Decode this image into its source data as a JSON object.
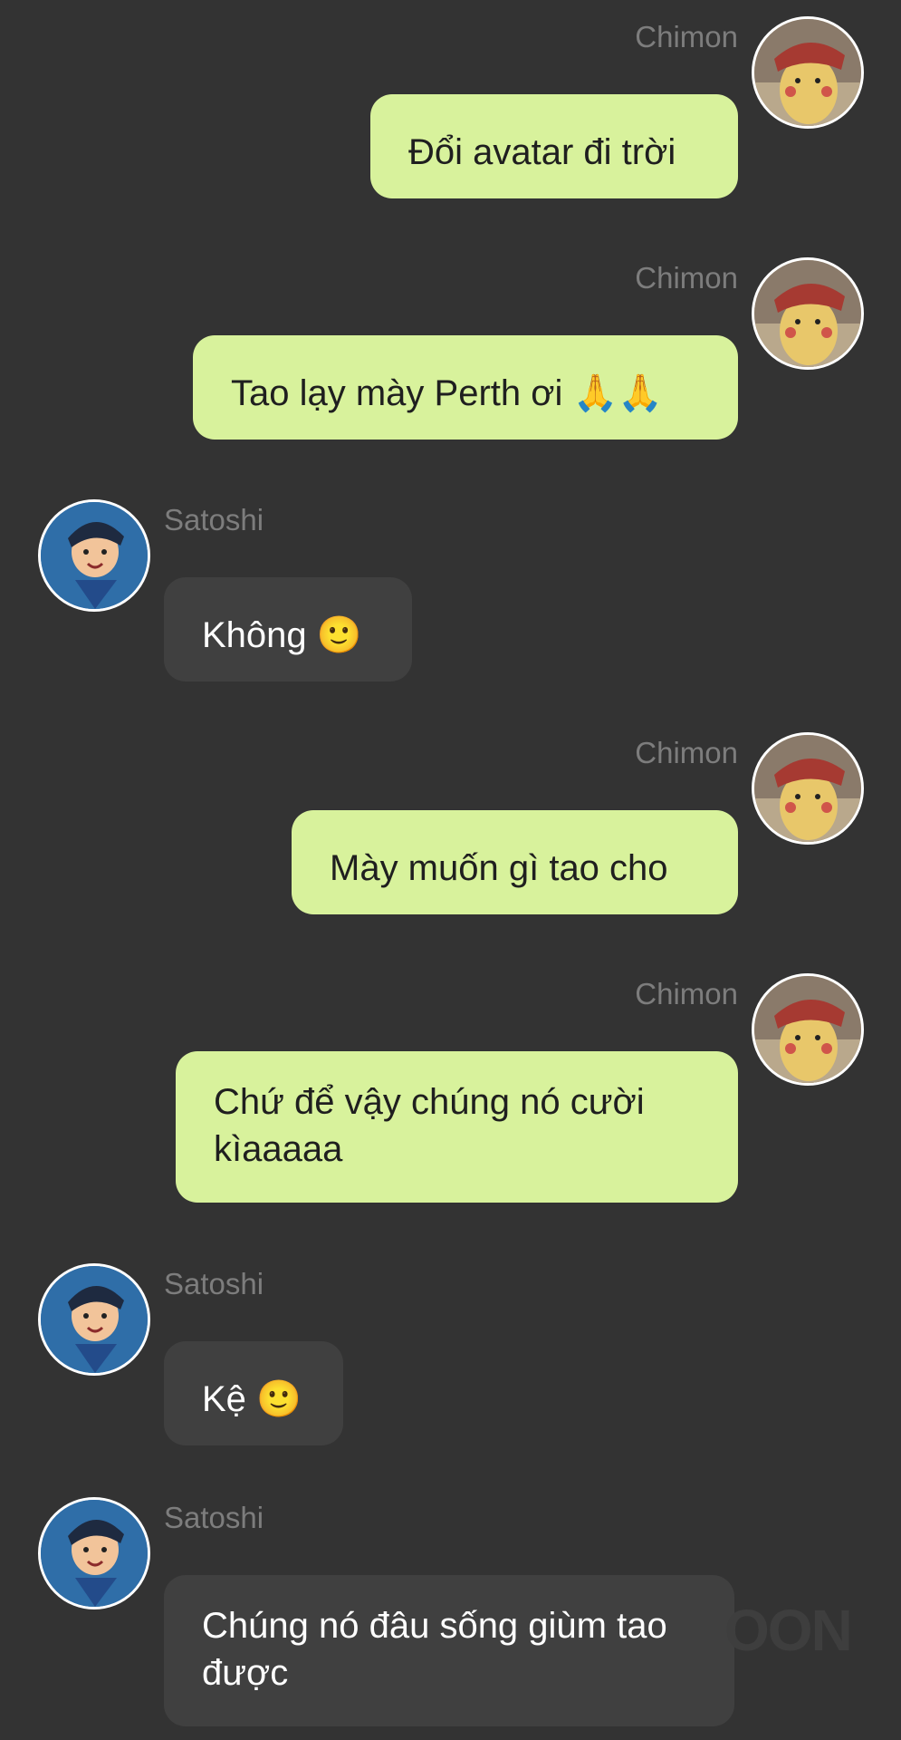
{
  "colors": {
    "background": "#333333",
    "outgoing_bubble": "#d8f29c",
    "incoming_bubble": "#404040",
    "sender_name": "#7d7d7d"
  },
  "messages": [
    {
      "direction": "out",
      "sender": "Chimon",
      "avatar_icon": "pikachu-avatar-icon",
      "text": "Đổi avatar đi trời"
    },
    {
      "direction": "out",
      "sender": "Chimon",
      "avatar_icon": "pikachu-avatar-icon",
      "text": "Tao lạy mày Perth ơi 🙏🙏"
    },
    {
      "direction": "in",
      "sender": "Satoshi",
      "avatar_icon": "ash-avatar-icon",
      "text": "Không 🙂"
    },
    {
      "direction": "out",
      "sender": "Chimon",
      "avatar_icon": "pikachu-avatar-icon",
      "text": "Mày muốn gì tao cho"
    },
    {
      "direction": "out",
      "sender": "Chimon",
      "avatar_icon": "pikachu-avatar-icon",
      "text": "Chứ để vậy chúng nó cười kìaaaaa"
    },
    {
      "direction": "in",
      "sender": "Satoshi",
      "avatar_icon": "ash-avatar-icon",
      "text": "Kệ 🙂"
    },
    {
      "direction": "in",
      "sender": "Satoshi",
      "avatar_icon": "ash-avatar-icon",
      "text": "Chúng nó đâu sống giùm tao được"
    }
  ],
  "watermark": "OON"
}
